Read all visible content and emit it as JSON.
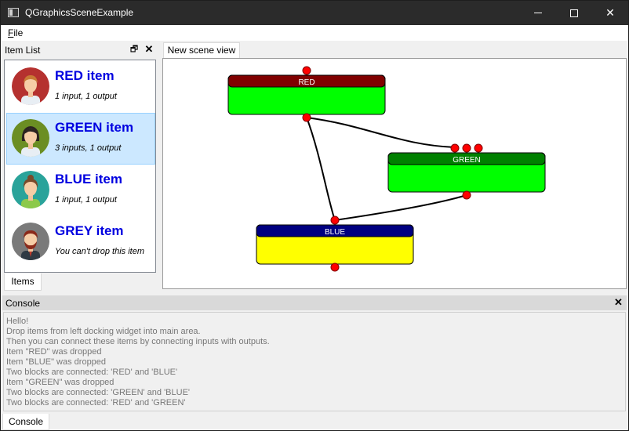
{
  "window": {
    "title": "QGraphicsSceneExample"
  },
  "menu": {
    "file_label": "File",
    "file_mnemonic": "F",
    "file_rest": "ile"
  },
  "item_dock": {
    "title": "Item List",
    "tab_label": "Items",
    "items": [
      {
        "name": "RED item",
        "desc": "1 input, 1 output",
        "avatar_bg": "#b5312f",
        "selected": false
      },
      {
        "name": "GREEN item",
        "desc": "3 inputs, 1 output",
        "avatar_bg": "#6b8e23",
        "selected": true
      },
      {
        "name": "BLUE item",
        "desc": "1 input, 1 output",
        "avatar_bg": "#2aa39a",
        "selected": false
      },
      {
        "name": "GREY item",
        "desc": "You can't drop this item",
        "avatar_bg": "#7a7a7a",
        "selected": false
      }
    ]
  },
  "scene_view": {
    "tab_label": "New scene view",
    "blocks": {
      "red": {
        "label": "RED",
        "header_color": "#800000",
        "body_color": "#00ff00"
      },
      "green": {
        "label": "GREEN",
        "header_color": "#008000",
        "body_color": "#00ff00"
      },
      "blue": {
        "label": "BLUE",
        "header_color": "#000080",
        "body_color": "#ffff00"
      }
    },
    "port_color": "#ff0000"
  },
  "console": {
    "title": "Console",
    "tab_label": "Console",
    "lines": [
      "Hello!",
      "Drop items from left docking widget into main area.",
      "Then you can connect these items by connecting inputs with outputs.",
      "Item \"RED\" was dropped",
      "Item \"BLUE\" was dropped",
      "Two blocks are connected: 'RED' and 'BLUE'",
      "Item \"GREEN\" was dropped",
      "Two blocks are connected: 'GREEN' and 'BLUE'",
      "Two blocks are connected: 'RED' and 'GREEN'"
    ]
  }
}
